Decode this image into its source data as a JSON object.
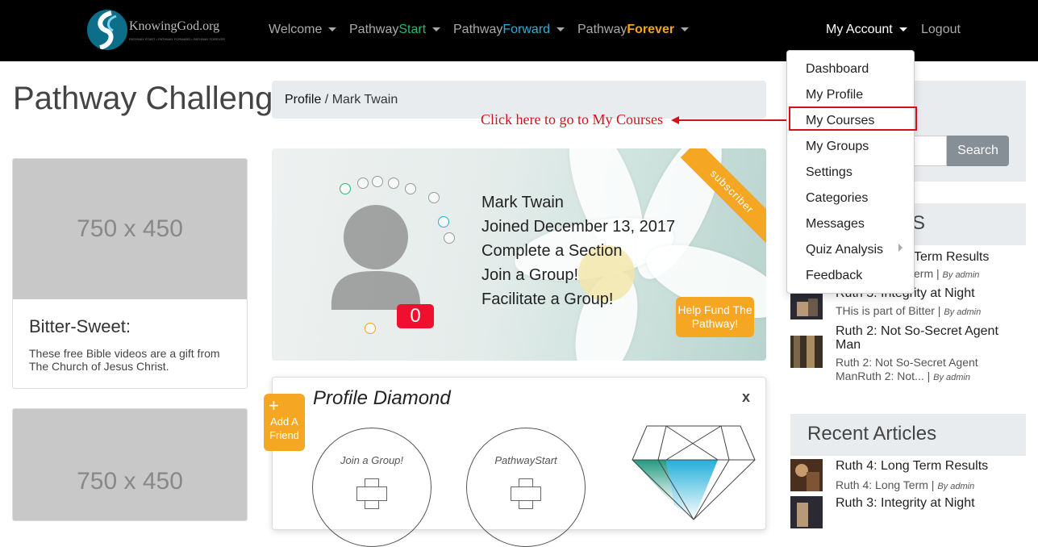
{
  "nav": {
    "logo_text": "KnowingGod.org",
    "logo_subtitle": "PATHWAY START • PATHWAY FORWARD • PATHWAY FOREVER",
    "items": [
      {
        "label": "Welcome"
      },
      {
        "prefix": "Pathway",
        "accent": "Start"
      },
      {
        "prefix": "Pathway",
        "accent": "Forward"
      },
      {
        "prefix": "Pathway",
        "accent": "Forever"
      }
    ],
    "account_label": "My Account",
    "logout_label": "Logout",
    "accent_colors": {
      "start": "#2ab573",
      "forward": "#2bb0d8",
      "forever": "#f4a31b"
    }
  },
  "account_menu": {
    "items": [
      "Dashboard",
      "My Profile",
      "My Courses",
      "My Groups",
      "Settings",
      "Categories",
      "Messages",
      "Quiz Analysis",
      "Feedback"
    ],
    "highlighted": "My Courses"
  },
  "annotation": {
    "text": "Click here to go to My Courses",
    "color": "#d6101a"
  },
  "sidebar_left": {
    "title": "Pathway Challenge",
    "cards": [
      {
        "placeholder": "750 x 450",
        "title": "Bitter-Sweet:",
        "text": "These free Bible videos are a gift from The Church of Jesus Christ."
      },
      {
        "placeholder": "750 x 450"
      }
    ]
  },
  "breadcrumb": {
    "root": "Profile",
    "separator": " / ",
    "current": "Mark Twain"
  },
  "profile": {
    "lines": [
      "Mark Twain",
      "Joined December 13, 2017",
      "Complete a Section",
      "Join a Group!",
      "Facilitate a Group!"
    ],
    "ribbon": "subscriber",
    "badge_count": "0",
    "help_button": "Help Fund The Pathway!"
  },
  "diamond": {
    "title": "Profile Diamond",
    "close": "x",
    "add_friend": {
      "plus": "+",
      "label": "Add A Friend"
    },
    "circles": [
      "Join a Group!",
      "PathwayStart"
    ]
  },
  "right_sidebar": {
    "search_button": "Search",
    "recent_heading_partial": "S",
    "recent_posts": [
      {
        "title_partial": "Term Results",
        "sub_partial": "erm",
        "by": "By admin"
      },
      {
        "title": "Ruth 3: Integrity at Night",
        "sub": "THis is part of Bitter",
        "by": "By admin"
      },
      {
        "title": "Ruth 2: Not So-Secret Agent Man",
        "sub": "Ruth 2: Not So-Secret Agent ManRuth 2: Not...",
        "by": "By admin"
      }
    ],
    "articles_heading": "Recent Articles",
    "recent_articles": [
      {
        "title": "Ruth 4: Long Term Results",
        "sub": "Ruth 4: Long Term",
        "by": "By admin"
      },
      {
        "title": "Ruth 3: Integrity at Night"
      }
    ]
  }
}
